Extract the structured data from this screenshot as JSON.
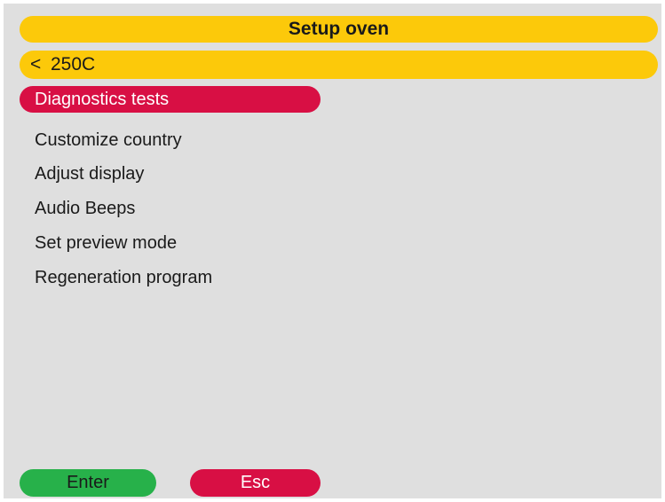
{
  "header": {
    "title": "Setup oven"
  },
  "temperature": {
    "arrow": "<",
    "value": "250C"
  },
  "menu": {
    "items": [
      {
        "label": "Diagnostics tests",
        "selected": true
      },
      {
        "label": "Customize country",
        "selected": false
      },
      {
        "label": "Adjust display",
        "selected": false
      },
      {
        "label": "Audio Beeps",
        "selected": false
      },
      {
        "label": "Set preview mode",
        "selected": false
      },
      {
        "label": "Regeneration program",
        "selected": false
      }
    ]
  },
  "buttons": {
    "enter_label": "Enter",
    "esc_label": "Esc"
  },
  "colors": {
    "header_bg": "#fcc90a",
    "selected_bg": "#d80f44",
    "enter_bg": "#27b14a",
    "esc_bg": "#d80f44",
    "screen_bg": "#dfdfdf"
  }
}
